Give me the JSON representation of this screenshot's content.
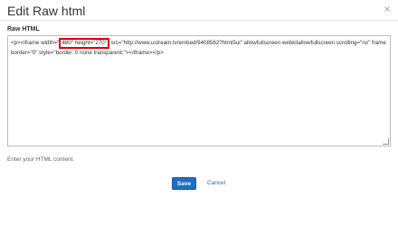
{
  "dialog": {
    "title": "Edit Raw html",
    "close_glyph": "×"
  },
  "field": {
    "label": "Raw HTML",
    "code_pre": "<p><iframe width=\"",
    "code_highlight": "480\" height=\"270\"",
    "code_post": " src=\"http://www.ustream.tv/embed/9408562?html5ui\" allowfullscreen webkitallowfullscreen scrolling=\"no\" frameborder=\"0\" style=\"border: 0 none transparent;\"></iframe></p>",
    "help_text": "Enter your HTML content."
  },
  "actions": {
    "save_label": "Save",
    "cancel_label": "Cancel"
  },
  "colors": {
    "primary_button": "#1c6fc4",
    "highlight_border": "#e00000",
    "link": "#2a6bbf"
  }
}
